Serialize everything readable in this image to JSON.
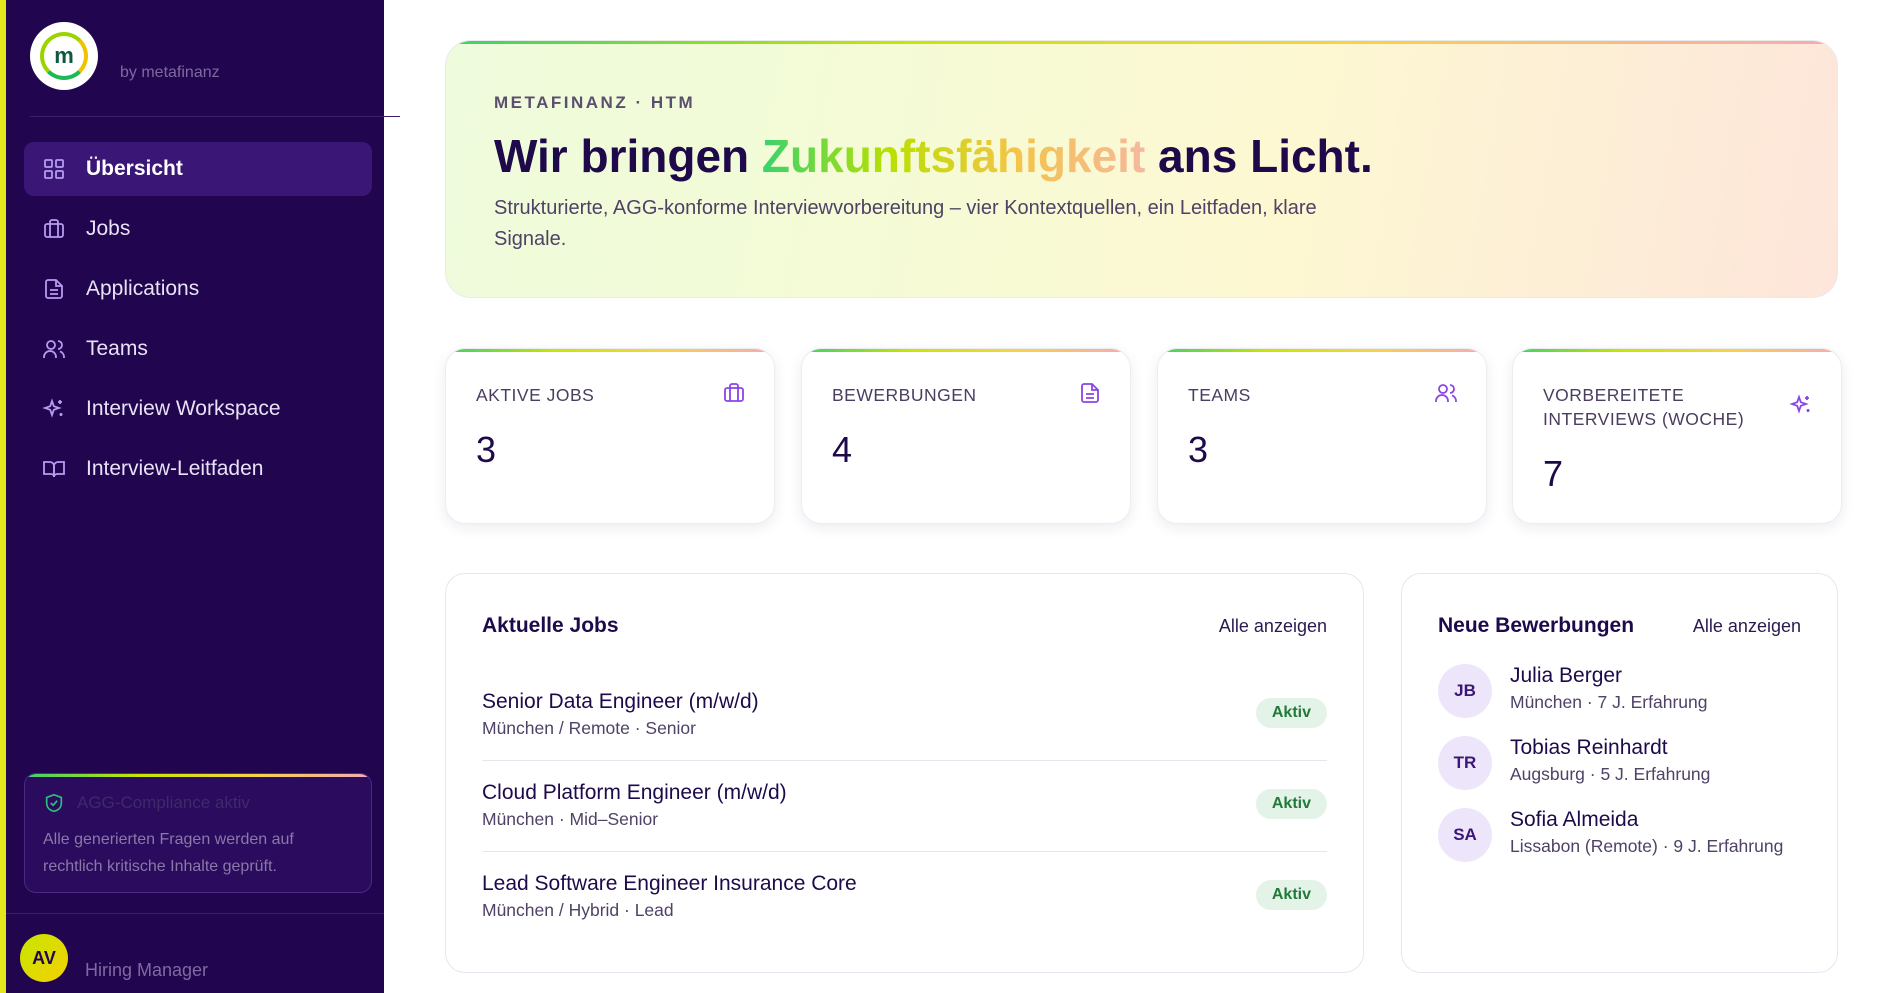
{
  "sidebar": {
    "brand_sub": "by metafinanz",
    "logo_letter": "m",
    "items": [
      {
        "label": "Übersicht",
        "icon": "grid-icon",
        "active": true
      },
      {
        "label": "Jobs",
        "icon": "briefcase-icon"
      },
      {
        "label": "Applications",
        "icon": "document-icon"
      },
      {
        "label": "Teams",
        "icon": "users-icon"
      },
      {
        "label": "Interview Workspace",
        "icon": "sparkles-icon"
      },
      {
        "label": "Interview-Leitfaden",
        "icon": "book-open-icon"
      }
    ],
    "compliance": {
      "title": "AGG-Compliance aktiv",
      "text": "Alle generierten Fragen werden auf rechtlich kritische Inhalte geprüft."
    },
    "user": {
      "initials": "AV",
      "role": "Hiring Manager"
    }
  },
  "hero": {
    "eyebrow": "METAFINANZ · HTM",
    "title_pre": "Wir bringen ",
    "title_highlight": "Zukunftsfähigkeit",
    "title_post": " ans Licht.",
    "description": "Strukturierte, AGG-konforme Interviewvorbereitung – vier Kontextquellen, ein Leitfaden, klare Signale."
  },
  "stats": [
    {
      "label": "AKTIVE JOBS",
      "value": "3",
      "icon": "briefcase-icon"
    },
    {
      "label": "BEWERBUNGEN",
      "value": "4",
      "icon": "document-icon"
    },
    {
      "label": "TEAMS",
      "value": "3",
      "icon": "users-icon"
    },
    {
      "label": "VORBEREITETE INTERVIEWS (WOCHE)",
      "value": "7",
      "icon": "sparkles-icon"
    }
  ],
  "jobs_panel": {
    "title": "Aktuelle Jobs",
    "link": "Alle anzeigen",
    "jobs": [
      {
        "title": "Senior Data Engineer (m/w/d)",
        "meta": "München / Remote · Senior",
        "status": "Aktiv"
      },
      {
        "title": "Cloud Platform Engineer (m/w/d)",
        "meta": "München · Mid–Senior",
        "status": "Aktiv"
      },
      {
        "title": "Lead Software Engineer Insurance Core",
        "meta": "München / Hybrid · Lead",
        "status": "Aktiv"
      }
    ]
  },
  "applications_panel": {
    "title": "Neue Bewerbungen",
    "link": "Alle anzeigen",
    "applications": [
      {
        "initials": "JB",
        "name": "Julia Berger",
        "meta": "München · 7 J. Erfahrung"
      },
      {
        "initials": "TR",
        "name": "Tobias Reinhardt",
        "meta": "Augsburg · 5 J. Erfahrung"
      },
      {
        "initials": "SA",
        "name": "Sofia Almeida",
        "meta": "Lissabon (Remote) · 9 J. Erfahrung"
      }
    ]
  },
  "colors": {
    "sidebar_bg": "#21054f",
    "accent_purple": "#8b45e6",
    "active_nav": "#3a1676",
    "badge_green": "#22793a"
  }
}
